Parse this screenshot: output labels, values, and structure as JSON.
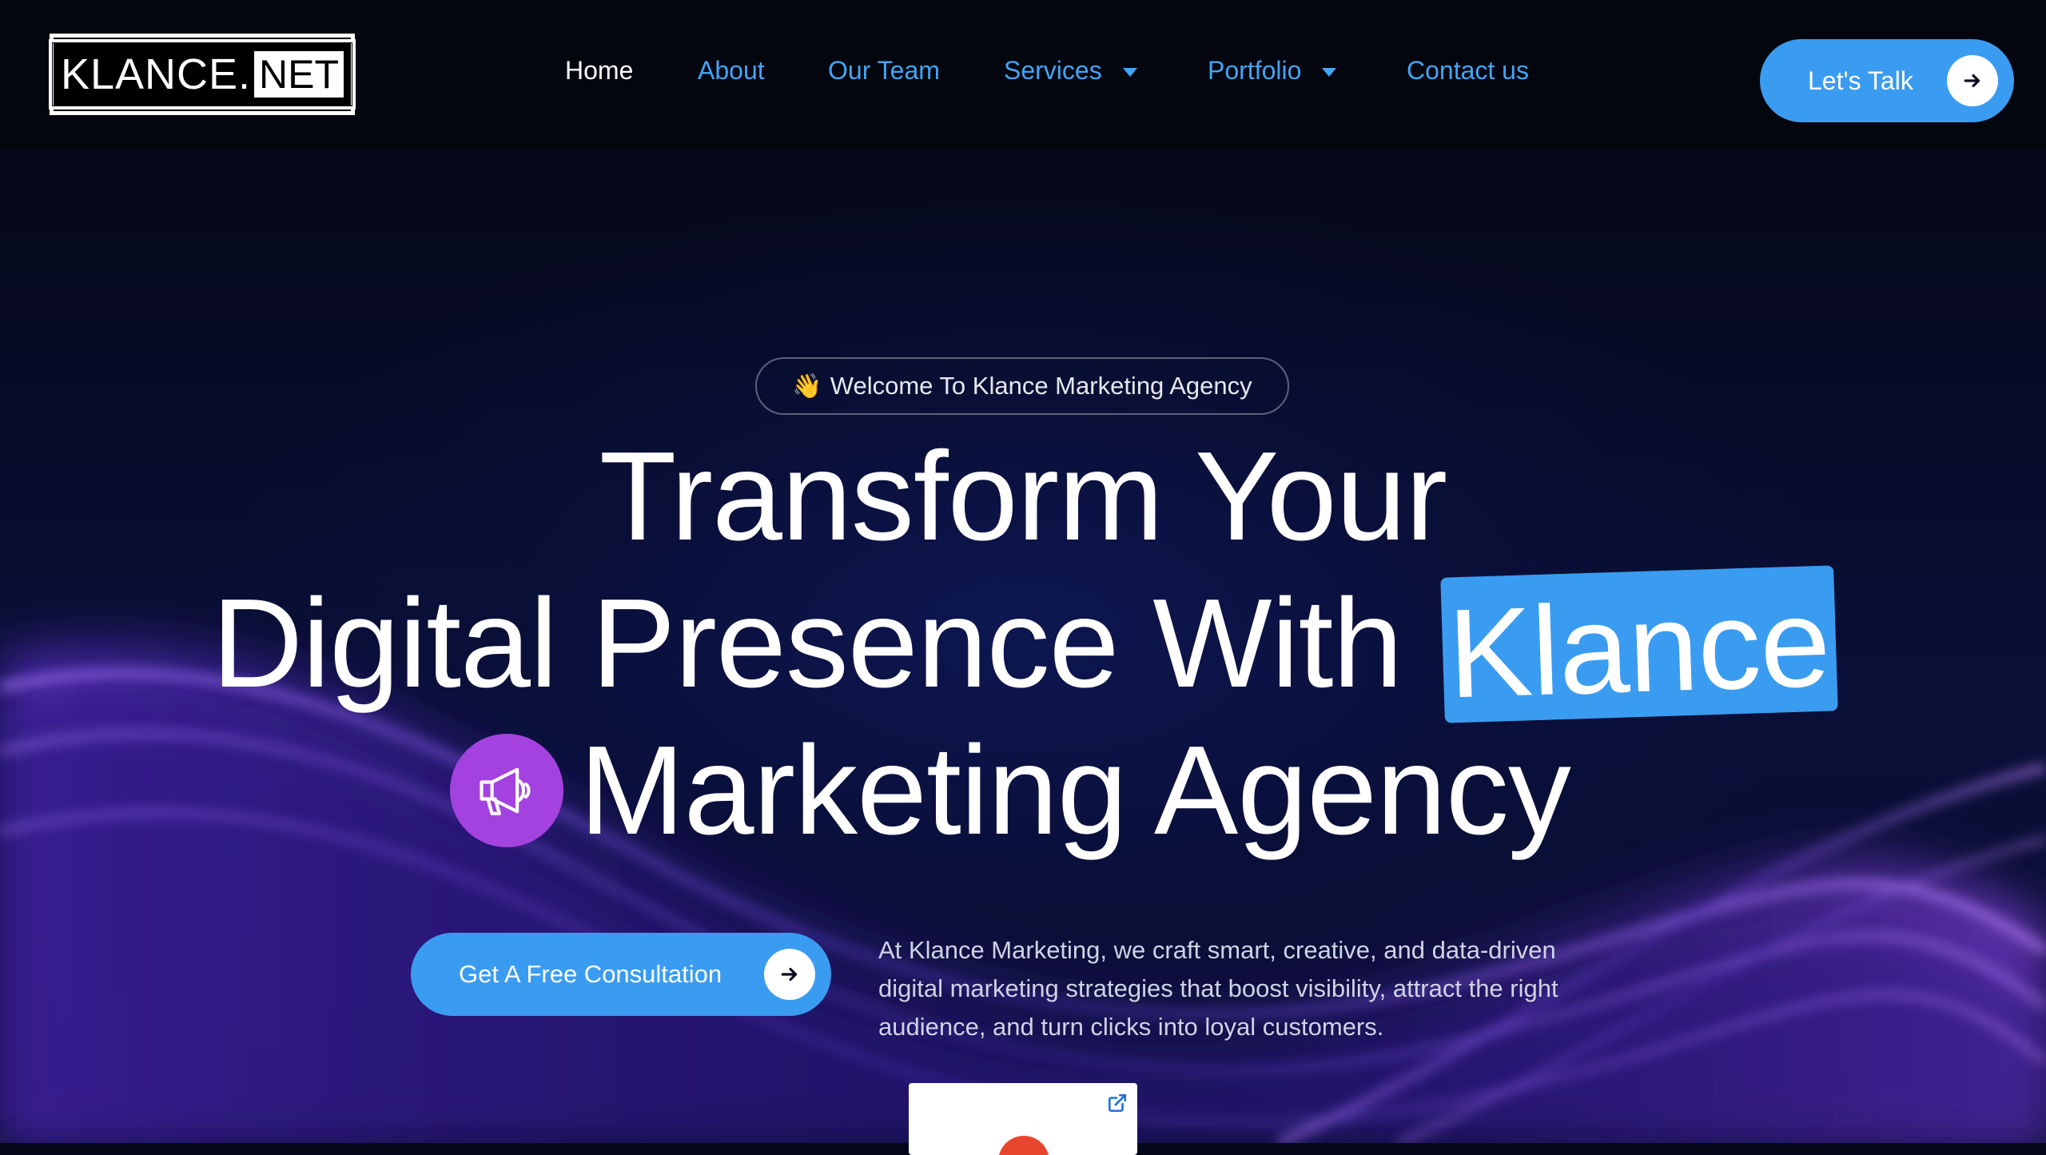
{
  "brand": {
    "logo_main": "KLANCE.",
    "logo_suffix": "NET"
  },
  "nav": {
    "items": [
      {
        "label": "Home",
        "active": true,
        "has_dropdown": false
      },
      {
        "label": "About",
        "active": false,
        "has_dropdown": false
      },
      {
        "label": "Our Team",
        "active": false,
        "has_dropdown": false
      },
      {
        "label": "Services",
        "active": false,
        "has_dropdown": true
      },
      {
        "label": "Portfolio",
        "active": false,
        "has_dropdown": true
      },
      {
        "label": "Contact us",
        "active": false,
        "has_dropdown": false
      }
    ],
    "cta_label": "Let's Talk"
  },
  "hero": {
    "welcome_emoji": "👋",
    "welcome_text": "Welcome To Klance Marketing Agency",
    "headline_line1": "Transform Your",
    "headline_line2": "Digital Presence With",
    "headline_highlight": "Klance",
    "headline_line3": "Marketing Agency",
    "cta_label": "Get A Free Consultation",
    "description": "At Klance Marketing, we craft smart, creative, and data-driven digital marketing strategies that boost visibility, attract the right audience, and turn clicks into loyal customers."
  },
  "icons": {
    "header_cta_arrow": "arrow-right-icon",
    "hero_cta_arrow": "arrow-right-icon",
    "headline_badge": "megaphone-icon",
    "card_corner": "external-link-icon",
    "dropdown": "caret-down-icon"
  },
  "colors": {
    "accent": "#3a9cf0",
    "nav_link": "#42a5f5",
    "badge_purple": "#a442e0",
    "background": "#050819"
  }
}
